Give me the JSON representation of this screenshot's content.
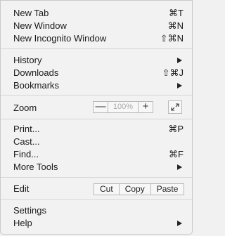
{
  "menu": {
    "new_tab": {
      "label": "New Tab",
      "shortcut": "⌘T"
    },
    "new_window": {
      "label": "New Window",
      "shortcut": "⌘N"
    },
    "new_incognito": {
      "label": "New Incognito Window",
      "shortcut": "⇧⌘N"
    },
    "history": {
      "label": "History"
    },
    "downloads": {
      "label": "Downloads",
      "shortcut": "⇧⌘J"
    },
    "bookmarks": {
      "label": "Bookmarks"
    },
    "zoom": {
      "label": "Zoom",
      "minus": "—",
      "value": "100%",
      "plus": "+"
    },
    "print": {
      "label": "Print...",
      "shortcut": "⌘P"
    },
    "cast": {
      "label": "Cast..."
    },
    "find": {
      "label": "Find...",
      "shortcut": "⌘F"
    },
    "more_tools": {
      "label": "More Tools"
    },
    "edit": {
      "label": "Edit",
      "cut": "Cut",
      "copy": "Copy",
      "paste": "Paste"
    },
    "settings": {
      "label": "Settings"
    },
    "help": {
      "label": "Help"
    }
  }
}
